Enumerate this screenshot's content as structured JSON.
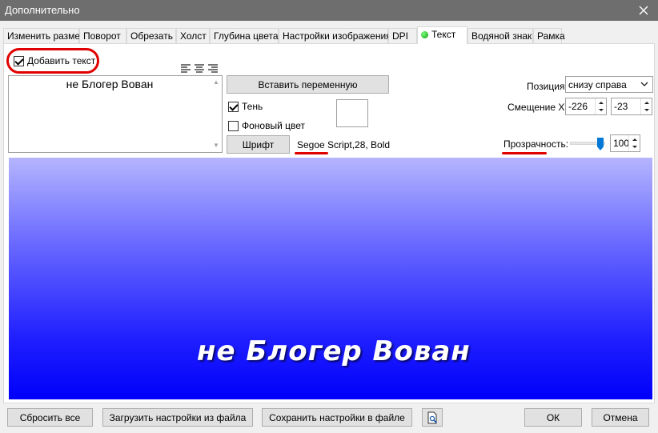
{
  "window": {
    "title": "Дополнительно"
  },
  "tabs": [
    {
      "label": "Изменить размер"
    },
    {
      "label": "Поворот"
    },
    {
      "label": "Обрезать"
    },
    {
      "label": "Холст"
    },
    {
      "label": "Глубина цвета"
    },
    {
      "label": "Настройки изображения"
    },
    {
      "label": "DPI"
    },
    {
      "label": "Текст",
      "active": true
    },
    {
      "label": "Водяной знак"
    },
    {
      "label": "Рамка"
    }
  ],
  "text_panel": {
    "add_text_label": "Добавить текст",
    "add_text_checked": true,
    "text_value": "не Блогер Вован",
    "insert_variable_button": "Вставить переменную",
    "shadow_label": "Тень",
    "shadow_checked": true,
    "bg_color_label": "Фоновый цвет",
    "bg_color_checked": false,
    "font_button": "Шрифт",
    "font_info": "Segoe Script,28, Bold",
    "position_label": "Позиция:",
    "position_value": "снизу справа",
    "offset_label": "Смещение XY:",
    "offset_x": "-226",
    "offset_y": "-23",
    "opacity_label": "Прозрачность:",
    "opacity_value": "100",
    "opacity_fraction": 1.0
  },
  "preview": {
    "overlay_text": "не Блогер Вован"
  },
  "bottom": {
    "reset_all": "Сбросить все",
    "load_settings": "Загрузить настройки из файла",
    "save_settings": "Сохранить настройки в файле",
    "ok": "ОК",
    "cancel": "Отмена"
  },
  "colors": {
    "annotation_red": "#e00000",
    "accent": "#0078d7",
    "preview_top": "#b5b5ff",
    "preview_bottom": "#0000fb"
  }
}
